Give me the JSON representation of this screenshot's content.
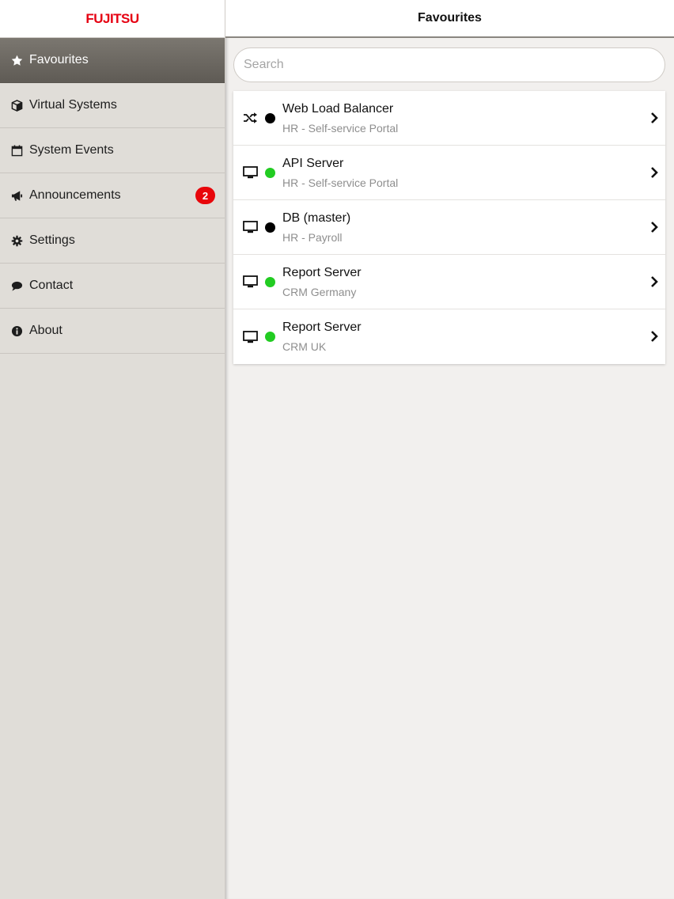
{
  "app": {
    "logo": "FUJITSU",
    "page_title": "Favourites"
  },
  "colors": {
    "online": "#22cc22",
    "offline": "#000000",
    "badge": "#e8060b",
    "logo": "#e60012"
  },
  "sidebar": {
    "items": [
      {
        "label": "Favourites",
        "icon": "star-icon",
        "active": true
      },
      {
        "label": "Virtual Systems",
        "icon": "cube-icon"
      },
      {
        "label": "System Events",
        "icon": "calendar-icon"
      },
      {
        "label": "Announcements",
        "icon": "megaphone-icon",
        "badge": "2"
      },
      {
        "label": "Settings",
        "icon": "gear-icon"
      },
      {
        "label": "Contact",
        "icon": "chat-bubble-icon"
      },
      {
        "label": "About",
        "icon": "info-icon"
      }
    ]
  },
  "search": {
    "placeholder": "Search",
    "value": ""
  },
  "favourites": [
    {
      "title": "Web Load Balancer",
      "subtitle": "HR - Self-service Portal",
      "type_icon": "shuffle-icon",
      "status": "offline"
    },
    {
      "title": "API Server",
      "subtitle": "HR - Self-service Portal",
      "type_icon": "monitor-icon",
      "status": "online"
    },
    {
      "title": "DB (master)",
      "subtitle": "HR - Payroll",
      "type_icon": "monitor-icon",
      "status": "offline"
    },
    {
      "title": "Report Server",
      "subtitle": "CRM Germany",
      "type_icon": "monitor-icon",
      "status": "online"
    },
    {
      "title": "Report Server",
      "subtitle": "CRM UK",
      "type_icon": "monitor-icon",
      "status": "online"
    }
  ]
}
